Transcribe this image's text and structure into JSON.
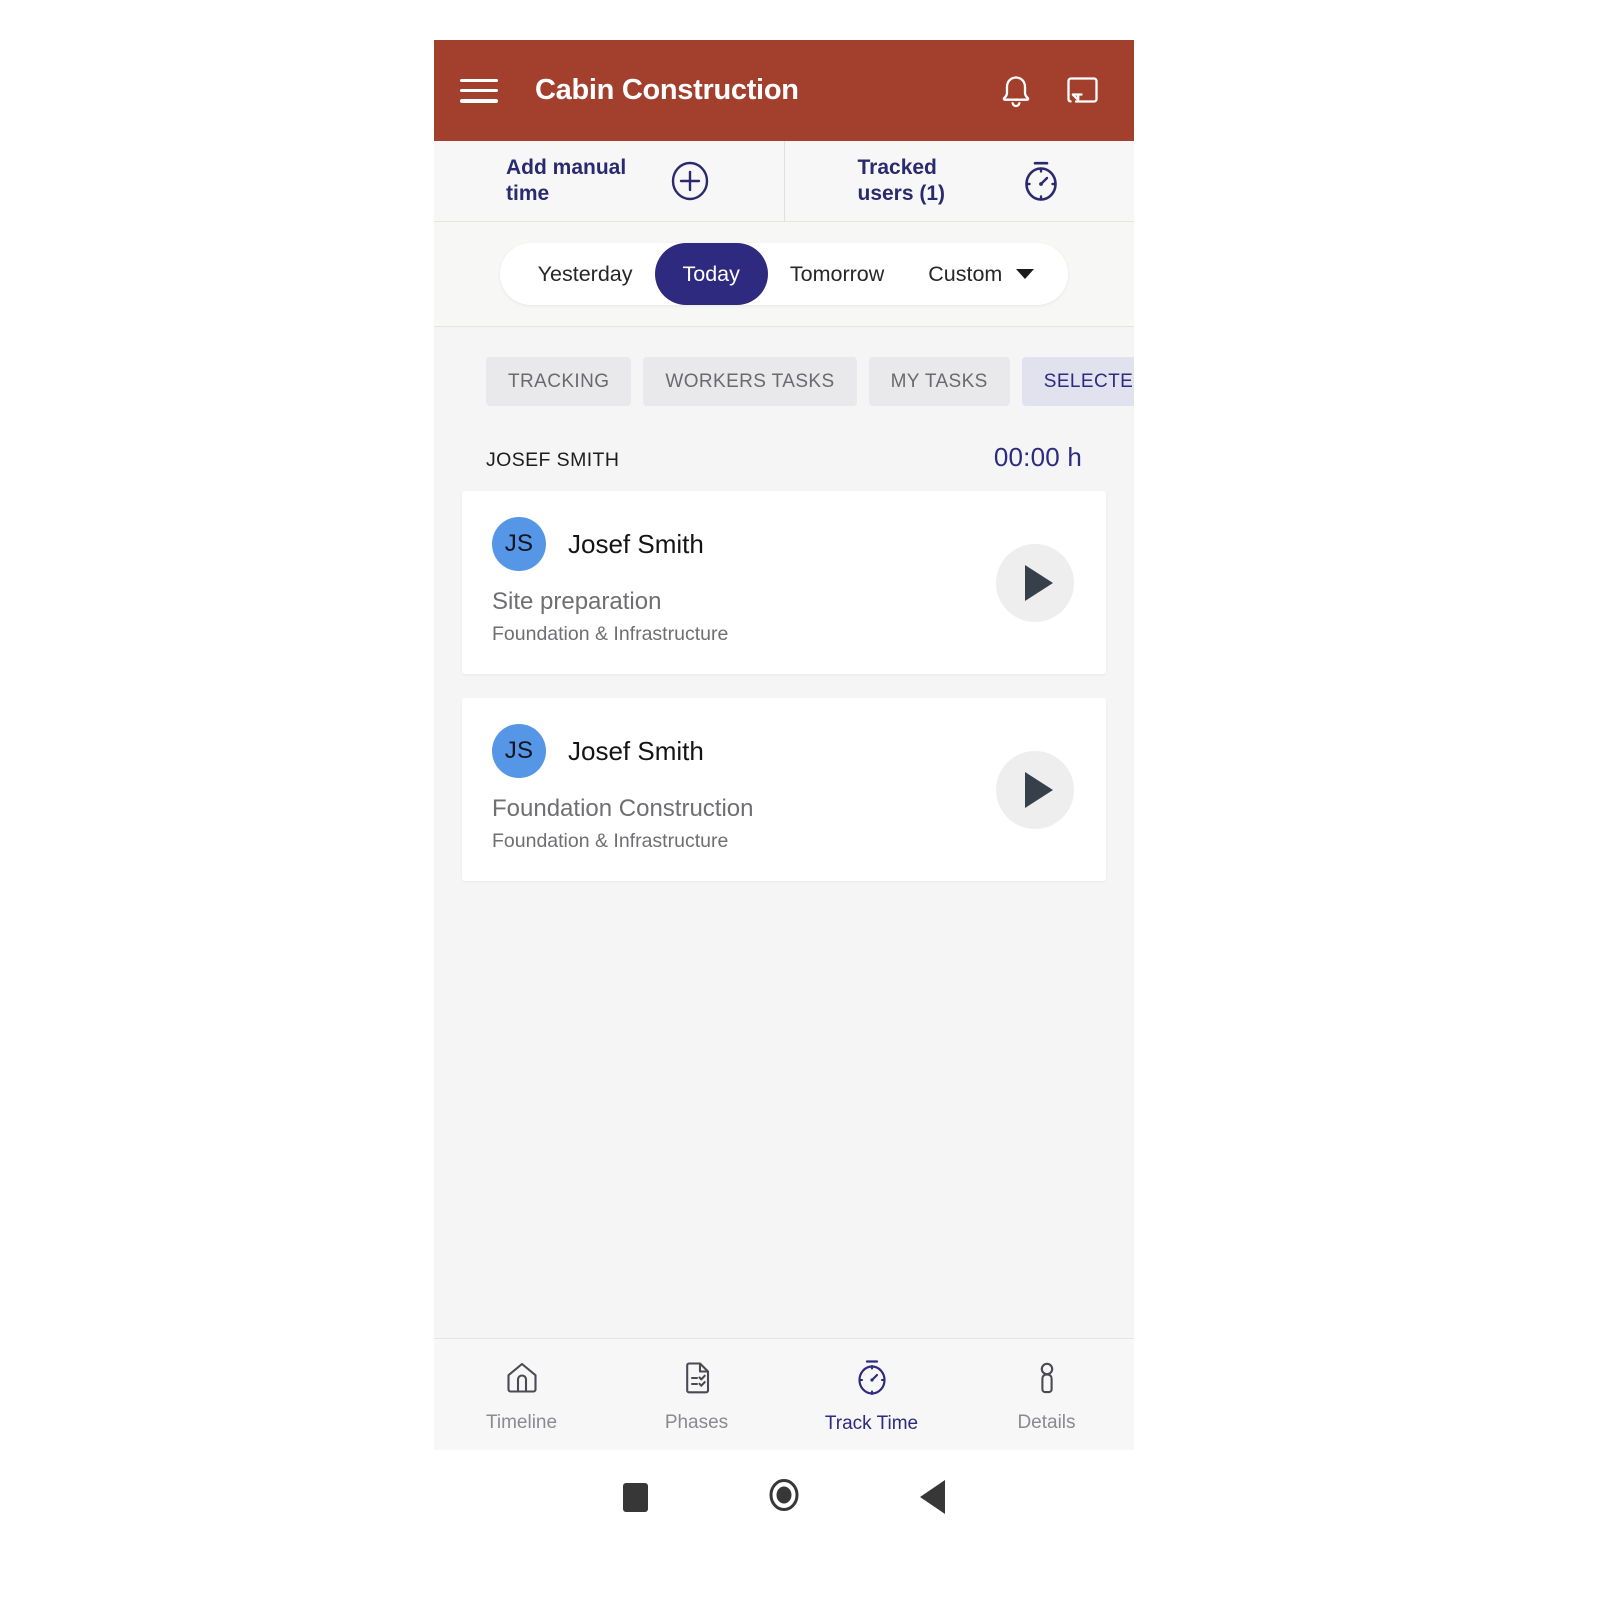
{
  "colors": {
    "appbar": "#a2402d",
    "accent": "#2e2a7f",
    "avatar": "#5596e6",
    "page_bg": "#f5f5f5"
  },
  "appbar": {
    "title": "Cabin Construction",
    "menu_icon": "hamburger-menu-icon",
    "notifications_icon": "bell-icon",
    "logout_icon": "logout-icon"
  },
  "actions": {
    "add_manual_time": {
      "label": "Add manual time",
      "icon": "plus-circle-icon"
    },
    "tracked_users": {
      "label": "Tracked users (1)",
      "icon": "stopwatch-icon"
    }
  },
  "date_filter": {
    "options": [
      "Yesterday",
      "Today",
      "Tomorrow",
      "Custom"
    ],
    "selected": "Today",
    "custom_label": "Custom",
    "caret_icon": "chevron-down-icon"
  },
  "tabs": {
    "items": [
      {
        "label": "TRACKING",
        "active": false
      },
      {
        "label": "WORKERS TASKS",
        "active": false
      },
      {
        "label": "MY TASKS",
        "active": false
      },
      {
        "label": "SELECTED USERS",
        "active": true
      }
    ]
  },
  "section": {
    "name": "JOSEF SMITH",
    "total": "00:00 h"
  },
  "entries": [
    {
      "initials": "JS",
      "user": "Josef Smith",
      "task": "Site preparation",
      "phase": "Foundation & Infrastructure",
      "play_icon": "play-icon"
    },
    {
      "initials": "JS",
      "user": "Josef Smith",
      "task": "Foundation Construction",
      "phase": "Foundation & Infrastructure",
      "play_icon": "play-icon"
    }
  ],
  "bottom_nav": {
    "items": [
      {
        "label": "Timeline",
        "icon": "home-icon",
        "active": false
      },
      {
        "label": "Phases",
        "icon": "document-checklist-icon",
        "active": false
      },
      {
        "label": "Track Time",
        "icon": "stopwatch-icon",
        "active": true
      },
      {
        "label": "Details",
        "icon": "person-icon",
        "active": false
      }
    ]
  },
  "system_nav": {
    "recents_icon": "square-icon",
    "home_icon": "circle-icon",
    "back_icon": "triangle-back-icon"
  }
}
